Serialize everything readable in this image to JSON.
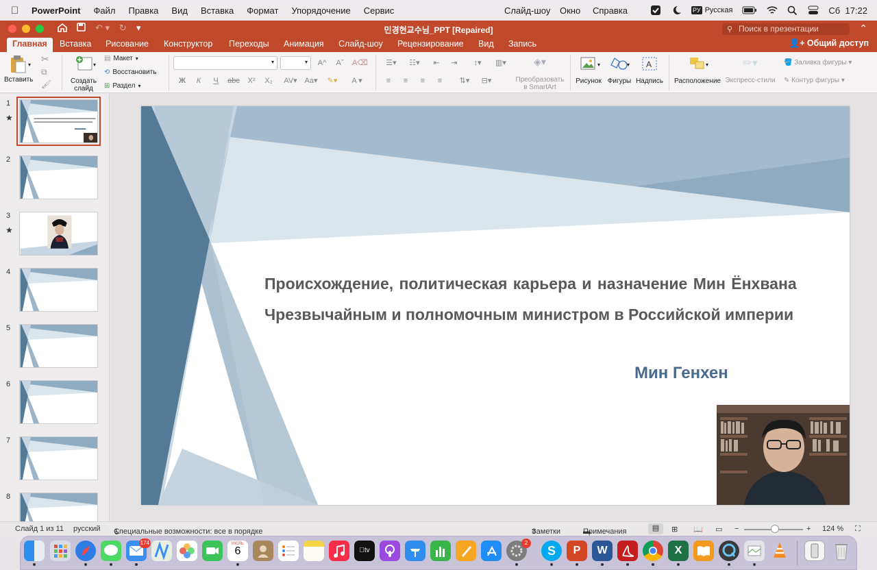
{
  "menubar": {
    "app_name": "PowerPoint",
    "items": [
      "Файл",
      "Правка",
      "Вид",
      "Вставка",
      "Формат",
      "Упорядочение",
      "Сервис"
    ],
    "right_items": [
      "Слайд-шоу",
      "Окно",
      "Справка"
    ],
    "input_badge": "РУ",
    "input_language": "Русская",
    "clock": "Сб  17:22"
  },
  "window": {
    "title": "민경현교수님_PPT [Repaired]",
    "search_placeholder": "Поиск в презентации"
  },
  "tabs": [
    "Главная",
    "Вставка",
    "Рисование",
    "Конструктор",
    "Переходы",
    "Анимация",
    "Слайд-шоу",
    "Рецензирование",
    "Вид",
    "Запись"
  ],
  "share_label": "Общий доступ",
  "ribbon": {
    "paste": "Вставить",
    "new_slide_line1": "Создать",
    "new_slide_line2": "слайд",
    "layout": "Макет",
    "reset": "Восстановить",
    "section": "Раздел",
    "smartart_line1": "Преобразовать",
    "smartart_line2": "в SmartArt",
    "picture": "Рисунок",
    "shapes": "Фигуры",
    "textbox": "Надпись",
    "arrange": "Расположение",
    "quick_styles": "Экспресс-стили",
    "shape_fill": "Заливка фигуры",
    "shape_outline": "Контур фигуры",
    "font_buttons": [
      "Ж",
      "К",
      "Ч",
      "abc",
      "X²",
      "X₂"
    ]
  },
  "thumbnails": [
    {
      "num": "1",
      "star": "★"
    },
    {
      "num": "2",
      "star": ""
    },
    {
      "num": "3",
      "star": "★"
    },
    {
      "num": "4",
      "star": ""
    },
    {
      "num": "5",
      "star": ""
    },
    {
      "num": "6",
      "star": ""
    },
    {
      "num": "7",
      "star": ""
    },
    {
      "num": "8",
      "star": ""
    }
  ],
  "slide": {
    "title_line1": "Происхождение, политическая карьера и назначение Мин Ёнхвана",
    "title_line2": "Чрезвычайным и полномочным министром в Российской империи",
    "author": "Мин Генхен"
  },
  "statusbar": {
    "slide_info": "Слайд 1 из 11",
    "language": "русский",
    "accessibility": "Специальные возможности: все в порядке",
    "notes": "Заметки",
    "comments": "Примечания",
    "zoom": "124 %"
  },
  "dock": {
    "mail_badge": "174",
    "calendar_month": "ИЮЛЬ",
    "calendar_day": "6",
    "settings_badge": "2"
  },
  "colors": {
    "ppt_accent": "#c0492b",
    "slide_blue_dark": "#557a96",
    "slide_blue_mid": "#8eabc2",
    "slide_blue_light": "#c7d6e2",
    "author_color": "#4a6a8e"
  }
}
